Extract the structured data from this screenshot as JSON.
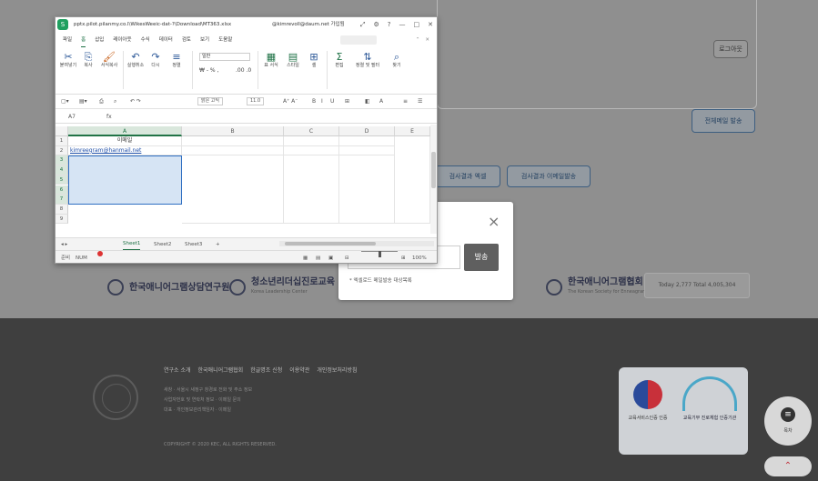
{
  "page": {
    "btn_b1": "로그아웃",
    "btn_b2": "전체메일 발송",
    "btn_b3": "검사결과 엑셀",
    "btn_b4": "검사결과 이메일발송",
    "logos": [
      {
        "name": "한국애니어그램상담연구원",
        "sub": ""
      },
      {
        "name": "청소년리더십진로교육",
        "sub": "Korea Leadership Center"
      },
      {
        "name": "한국애니어그램협회",
        "sub": "The Korean Society for Enneagram"
      }
    ],
    "visitor_label": "Today 2,777  Total 4,005,304"
  },
  "footer": {
    "links": [
      "연구소 소개",
      "한국애니어그램협회",
      "한글명조 신청",
      "이용약관",
      "개인정보처리방침"
    ],
    "lines": [
      "새창 · 서울시 새정구 창경로 전화 및 주소 정보",
      "사업자번호 및 연락처 정보 · 이메일 문의",
      "대표 · 개인정보관리책임자 · 이메일"
    ],
    "copyright": "COPYRIGHT © 2020 KEC, ALL RIGHTS RESERVED.",
    "cert_a_label": "교육서비스인증 인증",
    "cert_b_label": "교육기부 진로체험 인증기관",
    "float_label": "목차",
    "top_arrow": "⌃",
    "float_icon": "≡"
  },
  "modal": {
    "close": "×",
    "input_value": "",
    "send_label": "발송",
    "note": "* 엑셀로드 메일발송 대상목록"
  },
  "excel": {
    "app_icon": "S",
    "path": "pptx.pilot.pilanmy.co.l\\WikesWeeic-dat-?\\Download\\MT363.xlsx",
    "user": "@kimrevoll@daum.net 가입됨",
    "winctl": [
      "⤢",
      "⚙",
      "?",
      "—",
      "□",
      "✕"
    ],
    "menu": [
      "파일",
      "홈",
      "삽입",
      "레이아웃",
      "수식",
      "데이터",
      "검토",
      "보기",
      "도움말"
    ],
    "menu_active": 1,
    "menu_right": [
      "⌃",
      "✕"
    ],
    "ribbon": [
      {
        "label": "붙여넣기",
        "glyph": "✂",
        "cls": ""
      },
      {
        "label": "복사",
        "glyph": "⎘",
        "cls": ""
      },
      {
        "label": "서식복사",
        "glyph": "🖌",
        "cls": "o"
      },
      {
        "label": "실행취소",
        "glyph": "↶",
        "cls": ""
      },
      {
        "label": "다시",
        "glyph": "↷",
        "cls": ""
      },
      {
        "label": "정렬",
        "glyph": "≡",
        "cls": ""
      },
      {
        "label": "표 서식",
        "glyph": "▦",
        "cls": "g"
      },
      {
        "label": "스타일",
        "glyph": "▤",
        "cls": "g"
      },
      {
        "label": "셀",
        "glyph": "⊞",
        "cls": ""
      },
      {
        "label": "편집",
        "glyph": "Σ",
        "cls": "g"
      },
      {
        "label": "정렬 및 필터",
        "glyph": "⇅",
        "cls": ""
      },
      {
        "label": "찾기",
        "glyph": "⌕",
        "cls": ""
      }
    ],
    "font_name": "맑은 고딕",
    "font_size": "11.0",
    "number_format": "일반",
    "qat_font": "맑은 고딕",
    "qat_size": "11.0",
    "name_box": "A7",
    "formula": "fx",
    "columns": [
      "A",
      "B",
      "C",
      "D",
      "E"
    ],
    "rows": [
      "1",
      "2",
      "3",
      "4",
      "5",
      "6",
      "7",
      "8",
      "9"
    ],
    "header_cell": "이메일",
    "email_cell": "kimreegram@hanmail.net",
    "sheets": [
      "Sheet1",
      "Sheet2",
      "Sheet3",
      "+"
    ],
    "status_left": "준비",
    "status_num": "NUM",
    "zoom_label": "100%"
  }
}
